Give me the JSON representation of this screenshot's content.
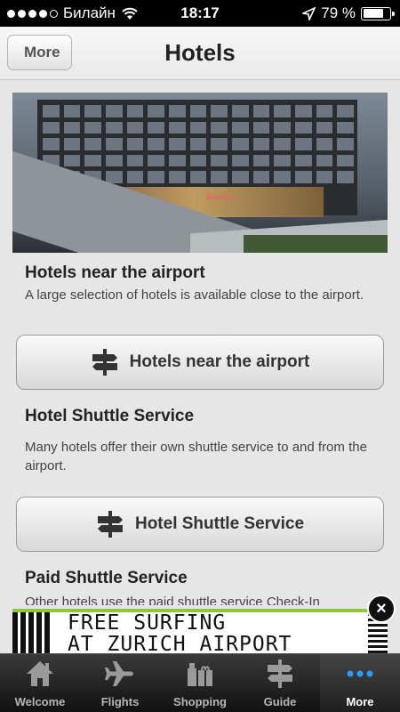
{
  "status_bar": {
    "carrier": "Билайн",
    "time": "18:17",
    "battery": "79 %",
    "battery_level": 0.79
  },
  "nav": {
    "back_label": "More",
    "title": "Hotels"
  },
  "sections": [
    {
      "heading": "Hotels near the airport",
      "text": "A large selection of hotels is available close to the airport.",
      "button": "Hotels near the airport"
    },
    {
      "heading": "Hotel Shuttle Service",
      "text": "Many hotels offer their own shuttle service to and from the airport.",
      "button": "Hotel Shuttle Service"
    },
    {
      "heading": "Paid Shuttle Service",
      "text": "Other hotels use the paid shuttle service Check-In"
    }
  ],
  "photo": {
    "sign": "Radisson"
  },
  "ad": {
    "line1": "FREE SURFING",
    "line2": "AT ZURICH AIRPORT",
    "close": "×",
    "accent": "#8dc63f"
  },
  "tabs": [
    {
      "label": "Welcome",
      "icon": "home-icon"
    },
    {
      "label": "Flights",
      "icon": "plane-icon"
    },
    {
      "label": "Shopping",
      "icon": "shopping-icon"
    },
    {
      "label": "Guide",
      "icon": "signpost-icon"
    },
    {
      "label": "More",
      "icon": "more-icon",
      "active": true
    }
  ]
}
